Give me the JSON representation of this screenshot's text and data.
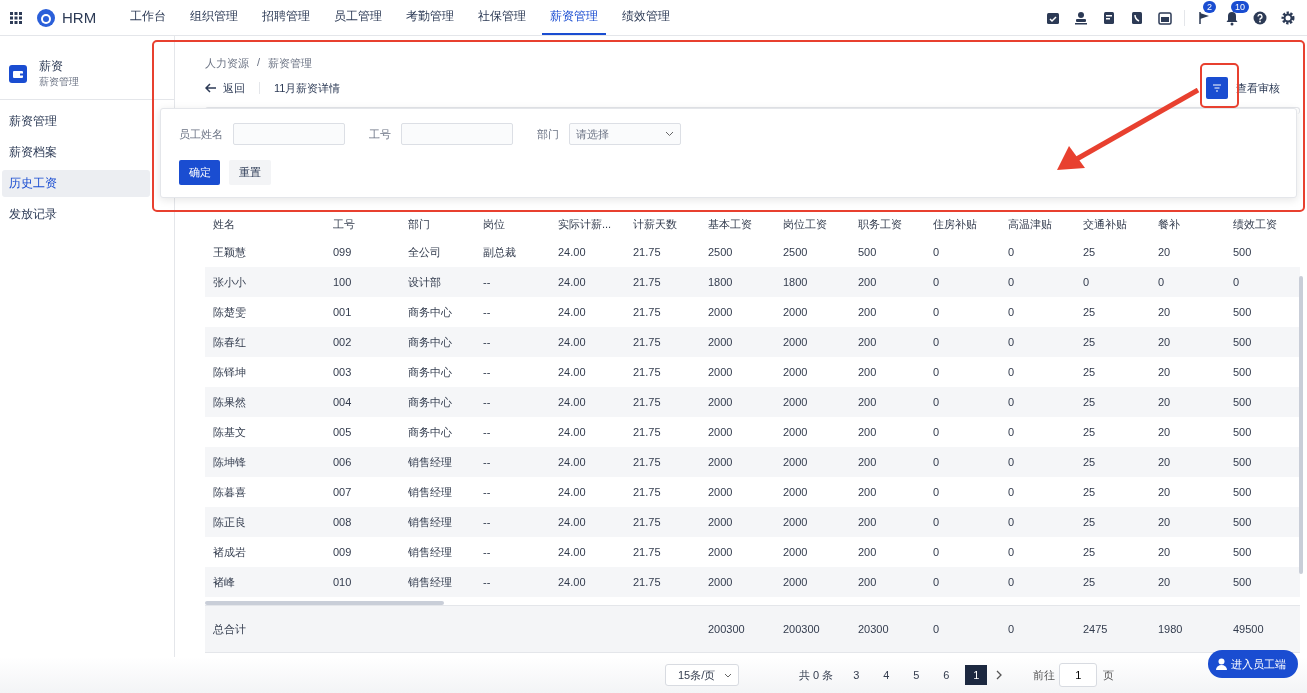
{
  "app": {
    "name": "HRM"
  },
  "nav": {
    "items": [
      {
        "label": "工作台",
        "selected": false
      },
      {
        "label": "组织管理",
        "selected": false
      },
      {
        "label": "招聘管理",
        "selected": false
      },
      {
        "label": "员工管理",
        "selected": false
      },
      {
        "label": "考勤管理",
        "selected": false
      },
      {
        "label": "社保管理",
        "selected": false
      },
      {
        "label": "薪资管理",
        "selected": true
      },
      {
        "label": "绩效管理",
        "selected": false
      }
    ],
    "tools": [
      {
        "kind": "calendar-check"
      },
      {
        "kind": "person"
      },
      {
        "kind": "document"
      },
      {
        "kind": "phone"
      },
      {
        "kind": "calendar"
      },
      {
        "kind": "flag",
        "badge": "2"
      },
      {
        "kind": "bell",
        "badge": "10"
      },
      {
        "kind": "help"
      },
      {
        "kind": "settings"
      }
    ]
  },
  "sidebar": {
    "title": "薪资",
    "subtitle": "薪资管理",
    "items": [
      {
        "label": "薪资管理",
        "selected": false
      },
      {
        "label": "薪资档案",
        "selected": false
      },
      {
        "label": "历史工资",
        "selected": true
      },
      {
        "label": "发放记录",
        "selected": false
      }
    ]
  },
  "breadcrumb": [
    "人力资源",
    "薪资管理"
  ],
  "breadcrumb_separator": "/",
  "back": "返回",
  "page_title": "11月薪资详情",
  "review": "查看审核",
  "filter": {
    "fields": [
      {
        "kind": "text",
        "label": "员工姓名"
      },
      {
        "kind": "text",
        "label": "工号"
      },
      {
        "kind": "select",
        "label": "部门",
        "placeholder": "请选择"
      }
    ],
    "confirm": "确定",
    "reset": "重置"
  },
  "table": {
    "columns": [
      "姓名",
      "工号",
      "部门",
      "岗位",
      "实际计薪...",
      "计薪天数",
      "基本工资",
      "岗位工资",
      "职务工资",
      "住房补贴",
      "高温津贴",
      "交通补贴",
      "餐补",
      "绩效工资"
    ],
    "rows": [
      [
        "王颖慧",
        "099",
        "全公司",
        "副总裁",
        "24.00",
        "21.75",
        "2500",
        "2500",
        "500",
        "0",
        "0",
        "25",
        "20",
        "500"
      ],
      [
        "张小小",
        "100",
        "设计部",
        "--",
        "24.00",
        "21.75",
        "1800",
        "1800",
        "200",
        "0",
        "0",
        "0",
        "0",
        "0"
      ],
      [
        "陈楚雯",
        "001",
        "商务中心",
        "--",
        "24.00",
        "21.75",
        "2000",
        "2000",
        "200",
        "0",
        "0",
        "25",
        "20",
        "500"
      ],
      [
        "陈春红",
        "002",
        "商务中心",
        "--",
        "24.00",
        "21.75",
        "2000",
        "2000",
        "200",
        "0",
        "0",
        "25",
        "20",
        "500"
      ],
      [
        "陈铎坤",
        "003",
        "商务中心",
        "--",
        "24.00",
        "21.75",
        "2000",
        "2000",
        "200",
        "0",
        "0",
        "25",
        "20",
        "500"
      ],
      [
        "陈果然",
        "004",
        "商务中心",
        "--",
        "24.00",
        "21.75",
        "2000",
        "2000",
        "200",
        "0",
        "0",
        "25",
        "20",
        "500"
      ],
      [
        "陈基文",
        "005",
        "商务中心",
        "--",
        "24.00",
        "21.75",
        "2000",
        "2000",
        "200",
        "0",
        "0",
        "25",
        "20",
        "500"
      ],
      [
        "陈坤锋",
        "006",
        "销售经理",
        "--",
        "24.00",
        "21.75",
        "2000",
        "2000",
        "200",
        "0",
        "0",
        "25",
        "20",
        "500"
      ],
      [
        "陈暮喜",
        "007",
        "销售经理",
        "--",
        "24.00",
        "21.75",
        "2000",
        "2000",
        "200",
        "0",
        "0",
        "25",
        "20",
        "500"
      ],
      [
        "陈正良",
        "008",
        "销售经理",
        "--",
        "24.00",
        "21.75",
        "2000",
        "2000",
        "200",
        "0",
        "0",
        "25",
        "20",
        "500"
      ],
      [
        "褚成岩",
        "009",
        "销售经理",
        "--",
        "24.00",
        "21.75",
        "2000",
        "2000",
        "200",
        "0",
        "0",
        "25",
        "20",
        "500"
      ],
      [
        "褚峰",
        "010",
        "销售经理",
        "--",
        "24.00",
        "21.75",
        "2000",
        "2000",
        "200",
        "0",
        "0",
        "25",
        "20",
        "500"
      ]
    ],
    "totals": {
      "label": "总合计",
      "values": [
        "200300",
        "200300",
        "20300",
        "0",
        "0",
        "2475",
        "1980",
        "49500"
      ]
    }
  },
  "pagination": {
    "page_size": "15条/页",
    "total": "共 0 条",
    "pages": [
      {
        "label": "3",
        "selected": false
      },
      {
        "label": "4",
        "selected": false
      },
      {
        "label": "5",
        "selected": false
      },
      {
        "label": "6",
        "selected": false
      },
      {
        "label": "1",
        "selected": true
      }
    ],
    "goto": "前往",
    "goto_value": "1",
    "goto_suffix": "页"
  },
  "float_button": "进入员工端"
}
